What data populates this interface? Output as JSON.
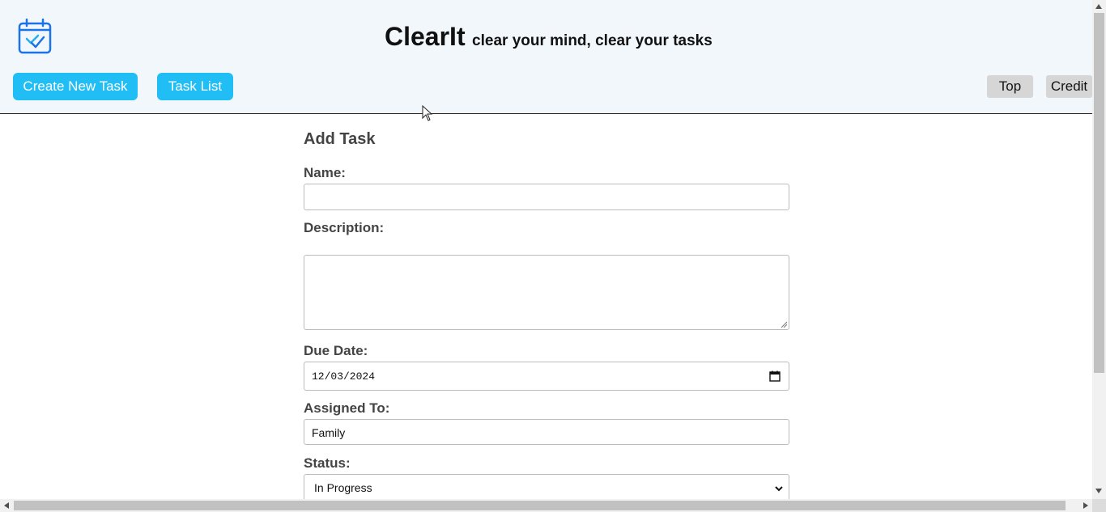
{
  "header": {
    "app_name": "ClearIt",
    "tagline": "clear your mind, clear your tasks",
    "logo_icon": "calendar-check-icon",
    "accent_color": "#20bef5",
    "nav": {
      "create_label": "Create New Task",
      "list_label": "Task List",
      "top_label": "Top",
      "credit_label": "Credit"
    }
  },
  "form": {
    "title": "Add Task",
    "name_label": "Name:",
    "name_value": "",
    "description_label": "Description:",
    "description_value": "",
    "due_date_label": "Due Date:",
    "due_date_value": "12/03/2024",
    "assigned_label": "Assigned To:",
    "assigned_value": "Family",
    "status_label": "Status:",
    "status_value": "In Progress"
  }
}
